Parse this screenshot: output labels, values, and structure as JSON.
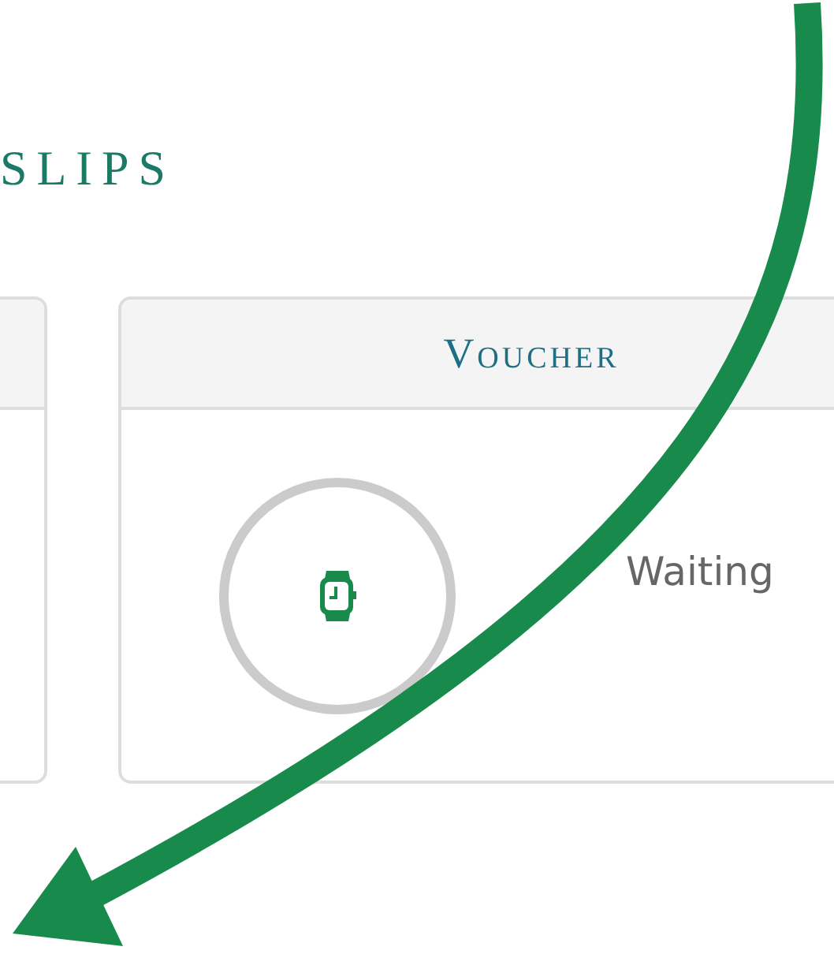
{
  "heading": "SLIPS",
  "cards": [
    {
      "kind": "blank"
    },
    {
      "kind": "status",
      "title": "Voucher",
      "status": "Waiting"
    }
  ]
}
